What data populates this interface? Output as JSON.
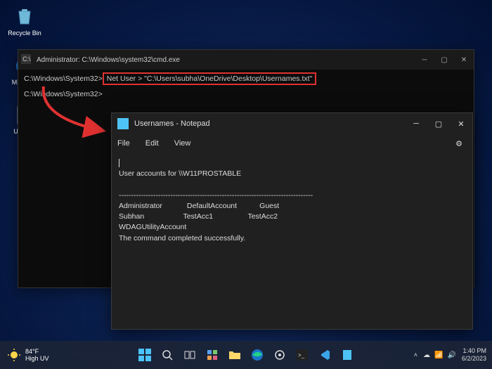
{
  "desktop": {
    "recycle": "Recycle Bin",
    "edge": "Microsoft Edge",
    "userfile": "Usern..."
  },
  "cmd": {
    "title": "Administrator: C:\\Windows\\system32\\cmd.exe",
    "line1_prompt": "C:\\Windows\\System32>",
    "line1_cmd": "Net User > \"C:\\Users\\subha\\OneDrive\\Desktop\\Usernames.txt\"",
    "line2_prompt": "C:\\Windows\\System32>"
  },
  "notepad": {
    "title": "Usernames - Notepad",
    "menu": {
      "file": "File",
      "edit": "Edit",
      "view": "View"
    },
    "content": "\nUser accounts for \\\\W11PROSTABLE\n\n-------------------------------------------------------------------------------\nAdministrator            DefaultAccount           Guest\nSubhan                   TestAcc1                 TestAcc2\nWDAGUtilityAccount\nThe command completed successfully."
  },
  "taskbar": {
    "weather_temp": "84°F",
    "weather_desc": "High UV",
    "time": "1:40 PM",
    "date": "6/2/2023"
  }
}
